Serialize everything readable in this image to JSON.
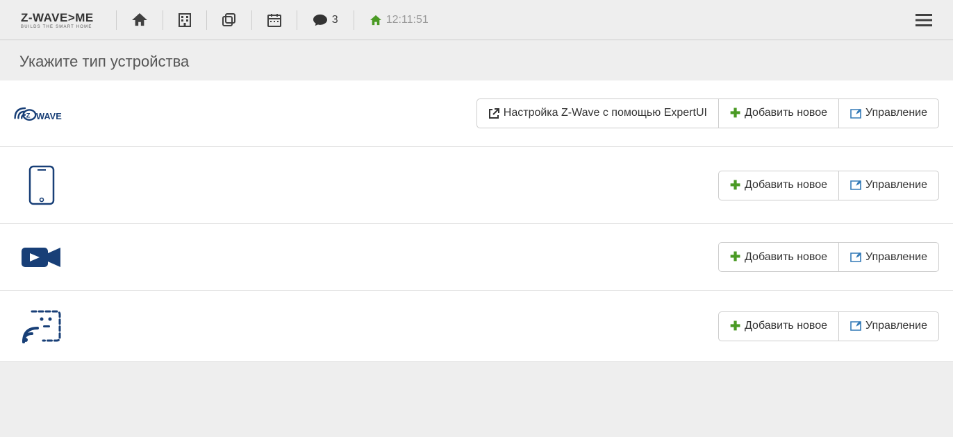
{
  "header": {
    "logo_main": "Z-WAVE>ME",
    "logo_sub": "BUILDS THE SMART HOME",
    "events_count": "3",
    "clock": "12:11:51"
  },
  "page": {
    "title": "Укажите тип устройства"
  },
  "buttons": {
    "expert": "Настройка Z-Wave с помощью ExpertUI",
    "add": "Добавить новое",
    "manage": "Управление"
  }
}
